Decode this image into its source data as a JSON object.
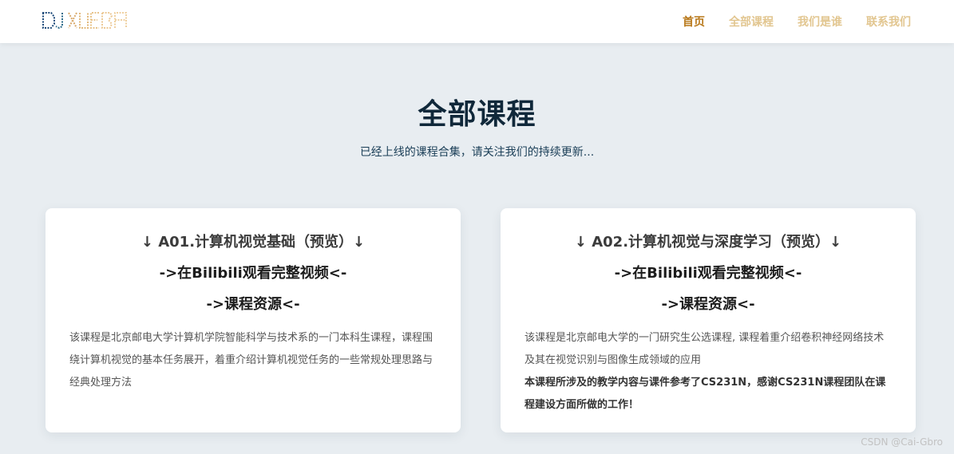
{
  "nav": {
    "items": [
      {
        "label": "首页",
        "active": true
      },
      {
        "label": "全部课程",
        "active": false
      },
      {
        "label": "我们是谁",
        "active": false
      },
      {
        "label": "联系我们",
        "active": false
      }
    ]
  },
  "hero": {
    "title": "全部课程",
    "subtitle": "已经上线的课程合集，请关注我们的持续更新..."
  },
  "courses": [
    {
      "title": "↓ A01.计算机视觉基础（预览）↓",
      "video_link": "->在Bilibili观看完整视频<-",
      "resource_link": "->课程资源<-",
      "description": "该课程是北京邮电大学计算机学院智能科学与技术系的一门本科生课程，课程围绕计算机视觉的基本任务展开，着重介绍计算机视觉任务的一些常规处理思路与经典处理方法",
      "note": ""
    },
    {
      "title": "↓ A02.计算机视觉与深度学习（预览）↓",
      "video_link": "->在Bilibili观看完整视频<-",
      "resource_link": "->课程资源<-",
      "description": "该课程是北京邮电大学的一门研究生公选课程, 课程着重介绍卷积神经网络技术及其在视觉识别与图像生成领域的应用",
      "note": "本课程所涉及的教学内容与课件参考了CS231N，感谢CS231N课程团队在课程建设方面所做的工作！"
    }
  ],
  "watermark": "CSDN @Cai-Gbro",
  "colors": {
    "nav_active": "#b8781a",
    "nav_inactive": "#e2c690",
    "title": "#10283a",
    "background": "#e8edf1"
  }
}
